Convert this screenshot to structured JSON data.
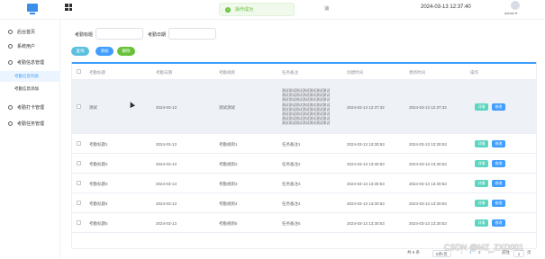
{
  "header": {
    "toast": "操作成功",
    "tail_text": "消",
    "clock": "2024-03-13 12:37:40",
    "user": "admin ▾"
  },
  "sidebar": {
    "items": [
      {
        "label": "后台首页"
      },
      {
        "label": "系统用户"
      },
      {
        "label": "考勤信息管理"
      },
      {
        "label": "考勤打卡管理"
      },
      {
        "label": "考勤任务管理"
      }
    ],
    "subs": [
      {
        "label": "考勤信息列表"
      },
      {
        "label": "考勤信息添加"
      }
    ]
  },
  "search": {
    "label1": "考勤标题",
    "label2": "考勤日期",
    "btn_search": "查询",
    "btn_add": "添加",
    "btn_delete": "删除"
  },
  "table": {
    "headers": [
      "考勤标题",
      "考勤日期",
      "考勤规则",
      "任务备注",
      "创建时间",
      "更新时间",
      "操作"
    ],
    "row1": {
      "title": "测试",
      "date": "2024-03-13",
      "rule": "测试测试",
      "note": "测试测试测试测试测试测试测试\n测试测试测试测试测试测试测试\n测试测试测试测试测试测试测试\n测试测试测试测试测试测试测试\n测试测试测试测试测试测试测试\n测试测试测试测试测试测试测试\n测试测试测试测试测试测试测试\n测试测试测试测试测试测试测试",
      "created": "2024-03-13 12:37:32",
      "updated": "2024-03-13 12:37:32"
    },
    "rows": [
      {
        "title": "考勤标题1",
        "date": "2024-03-13",
        "rule": "考勤规则1",
        "note": "任务备注1",
        "created": "2024-03-13 13:30:53",
        "updated": "2024-03-13 13:30:53"
      },
      {
        "title": "考勤标题2",
        "date": "2024-03-13",
        "rule": "考勤规则2",
        "note": "任务备注2",
        "created": "2024-03-13 13:30:53",
        "updated": "2024-03-13 13:30:53"
      },
      {
        "title": "考勤标题3",
        "date": "2024-03-13",
        "rule": "考勤规则3",
        "note": "任务备注3",
        "created": "2024-03-13 13:30:53",
        "updated": "2024-03-13 13:30:53"
      },
      {
        "title": "考勤标题4",
        "date": "2024-03-13",
        "rule": "考勤规则4",
        "note": "任务备注4",
        "created": "2024-03-13 13:30:53",
        "updated": "2024-03-13 13:30:53"
      },
      {
        "title": "考勤标题5",
        "date": "2024-03-13",
        "rule": "考勤规则5",
        "note": "任务备注5",
        "created": "2024-03-13 13:30:53",
        "updated": "2024-03-13 13:30:53"
      }
    ],
    "btn_detail": "详情",
    "btn_edit": "修改"
  },
  "pager": {
    "total": "共 6 条",
    "size": "5条/页",
    "page1": "1",
    "page2": "2",
    "next": "›",
    "goto": "前往",
    "page_input": "1",
    "page_suffix": "页"
  },
  "watermark": "CSDN @MZ_ZXD001",
  "colors": {
    "primary": "#409eff",
    "success": "#67c23a",
    "teal": "#5cd6c0",
    "danger": "#f56c6c"
  }
}
